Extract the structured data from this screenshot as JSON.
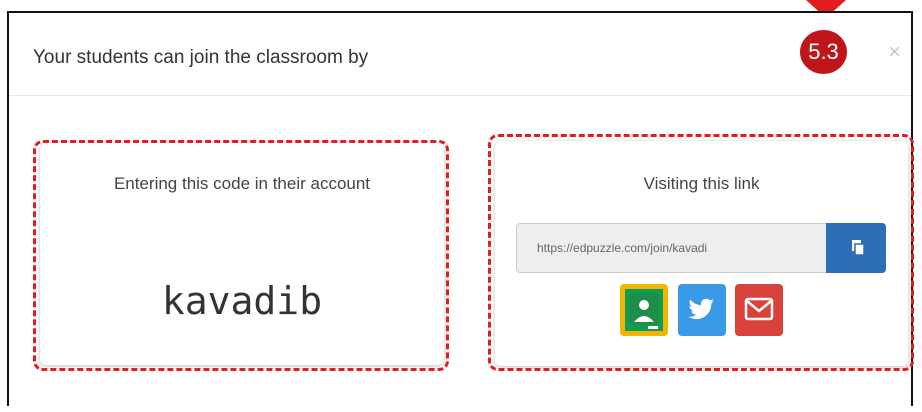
{
  "modal": {
    "title": "Your students can join the classroom by",
    "close_label": "×",
    "step_badge": "5.3"
  },
  "code_option": {
    "label": "Entering this code in their account",
    "code": "kavadib"
  },
  "link_option": {
    "label": "Visiting this link",
    "url": "https://edpuzzle.com/join/kavadi"
  },
  "share_buttons": [
    {
      "icon": "google-classroom-icon",
      "color": "#0f9d58"
    },
    {
      "icon": "twitter-icon",
      "color": "#3a9ae8"
    },
    {
      "icon": "email-icon",
      "color": "#d9423a"
    }
  ],
  "colors": {
    "highlight": "#e31d1d",
    "badge": "#c0151b",
    "copy_button": "#2d6fb6"
  }
}
